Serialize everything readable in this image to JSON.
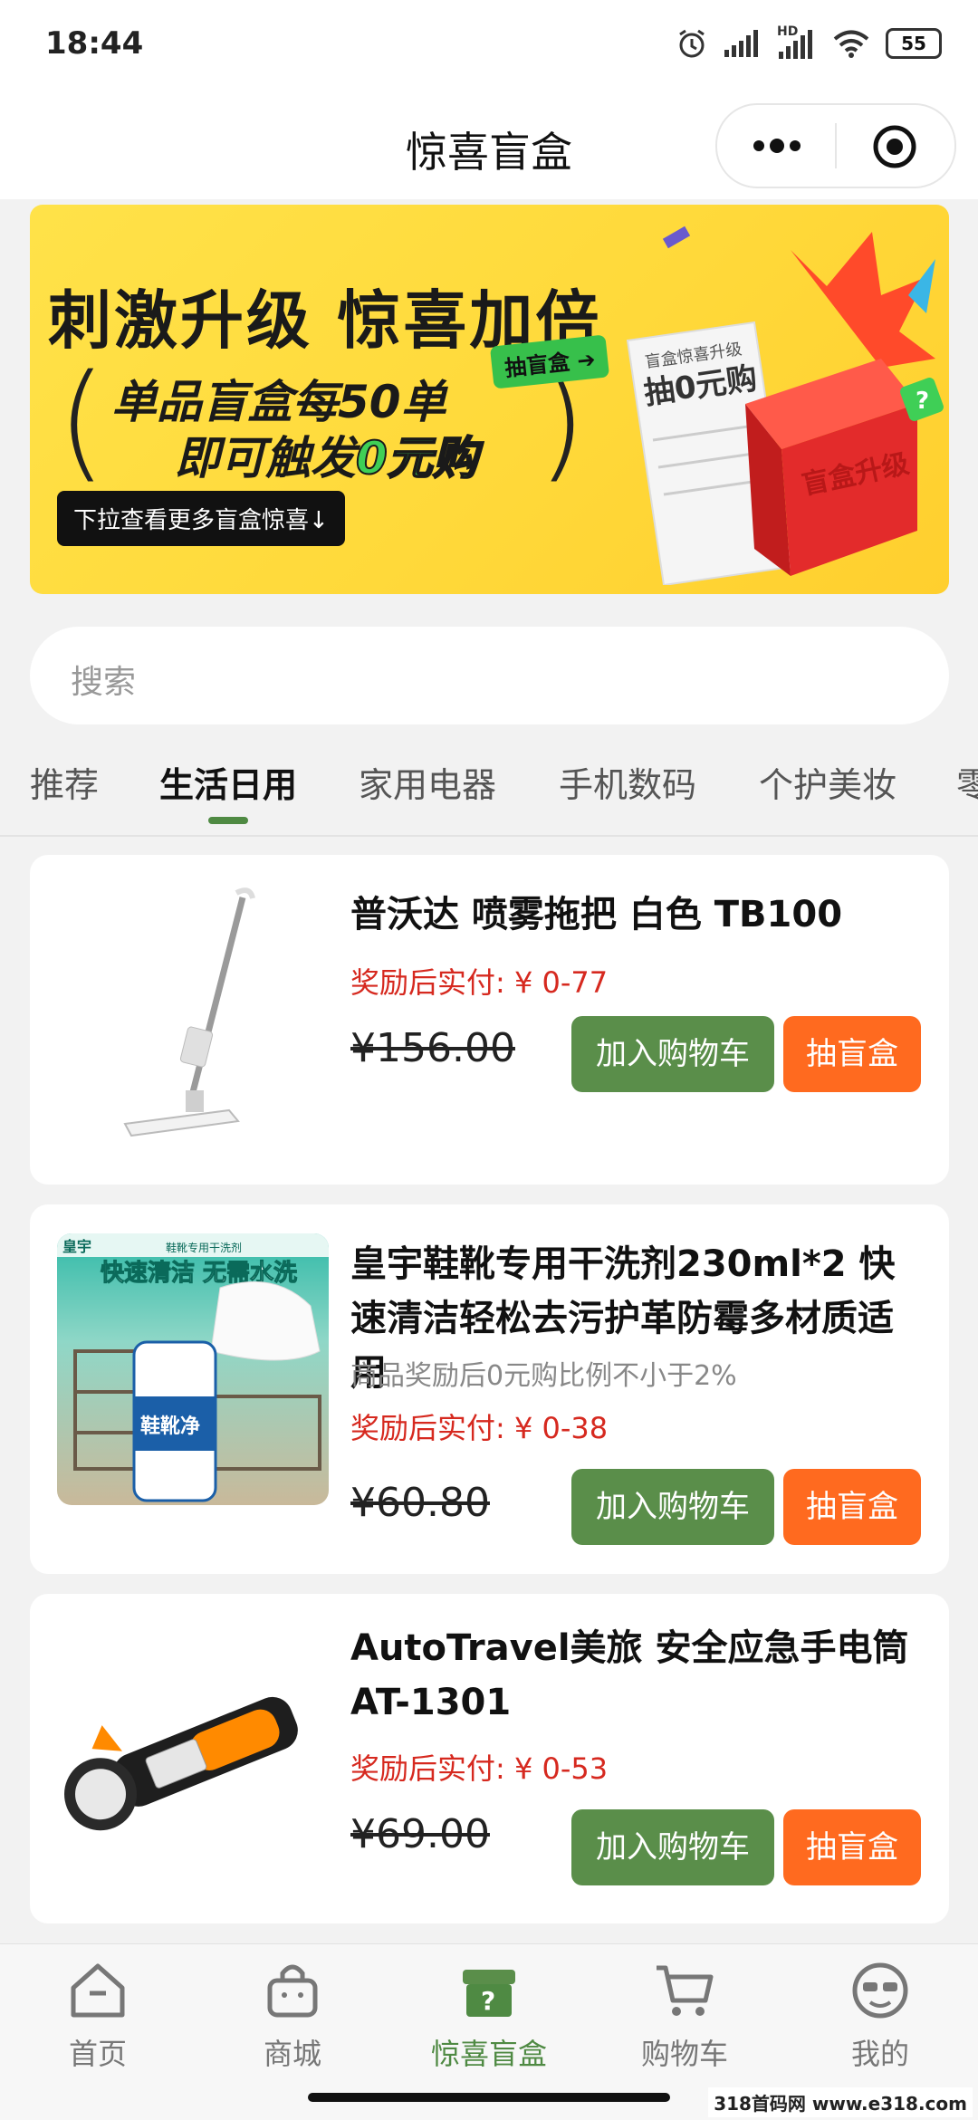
{
  "status_bar": {
    "time": "18:44",
    "battery": "55",
    "hd_label": "HD"
  },
  "header": {
    "title": "惊喜盲盒"
  },
  "banner": {
    "headline": "刺激升级 惊喜加倍",
    "line2": "单品盲盒每50单",
    "line3_prefix": "即可触发",
    "line3_highlight": "0元购",
    "tag": "抽盲盒",
    "cta": "下拉查看更多盲盒惊喜↓",
    "receipt_title": "盲盒惊喜升级",
    "receipt_big": "抽0元购",
    "box_text": "盲盒升级",
    "colors": {
      "background": "#ffde43",
      "accent_green": "#3fcf56",
      "box_red": "#e32b2b"
    }
  },
  "search": {
    "placeholder": "搜索"
  },
  "tabs": [
    "推荐",
    "生活日用",
    "家用电器",
    "手机数码",
    "个护美妆",
    "零"
  ],
  "active_tab": "生活日用",
  "products": [
    {
      "name": "普沃达 喷雾拖把 白色 TB100",
      "reward": "奖励后实付: ¥ 0-77",
      "price": "¥156.00",
      "cart_label": "加入购物车",
      "box_label": "抽盲盒"
    },
    {
      "name": "皇宇鞋靴专用干洗剂230ml*2 快速清洁轻松去污护革防霉多材质适用",
      "subtitle": "商品奖励后0元购比例不小于2%",
      "reward": "奖励后实付: ¥ 0-38",
      "price": "¥60.80",
      "cart_label": "加入购物车",
      "box_label": "抽盲盒",
      "image_texts": [
        "皇宇",
        "鞋靴专用干洗剂",
        "快速清洁 无需水洗",
        "鞋靴净"
      ]
    },
    {
      "name": "AutoTravel美旅 安全应急手电筒 AT-1301",
      "reward": "奖励后实付: ¥ 0-53",
      "price": "¥69.00",
      "cart_label": "加入购物车",
      "box_label": "抽盲盒"
    }
  ],
  "bottom_nav": [
    {
      "label": "首页",
      "icon": "home-icon"
    },
    {
      "label": "商城",
      "icon": "bag-icon"
    },
    {
      "label": "惊喜盲盒",
      "icon": "mystery-box-icon",
      "active": true
    },
    {
      "label": "购物车",
      "icon": "cart-icon"
    },
    {
      "label": "我的",
      "icon": "profile-icon"
    }
  ],
  "watermark": "318首码网 www.e318.com",
  "theme": {
    "primary_green": "#5a8e4a",
    "orange": "#ff6a1f",
    "price_red": "#d6291f"
  }
}
